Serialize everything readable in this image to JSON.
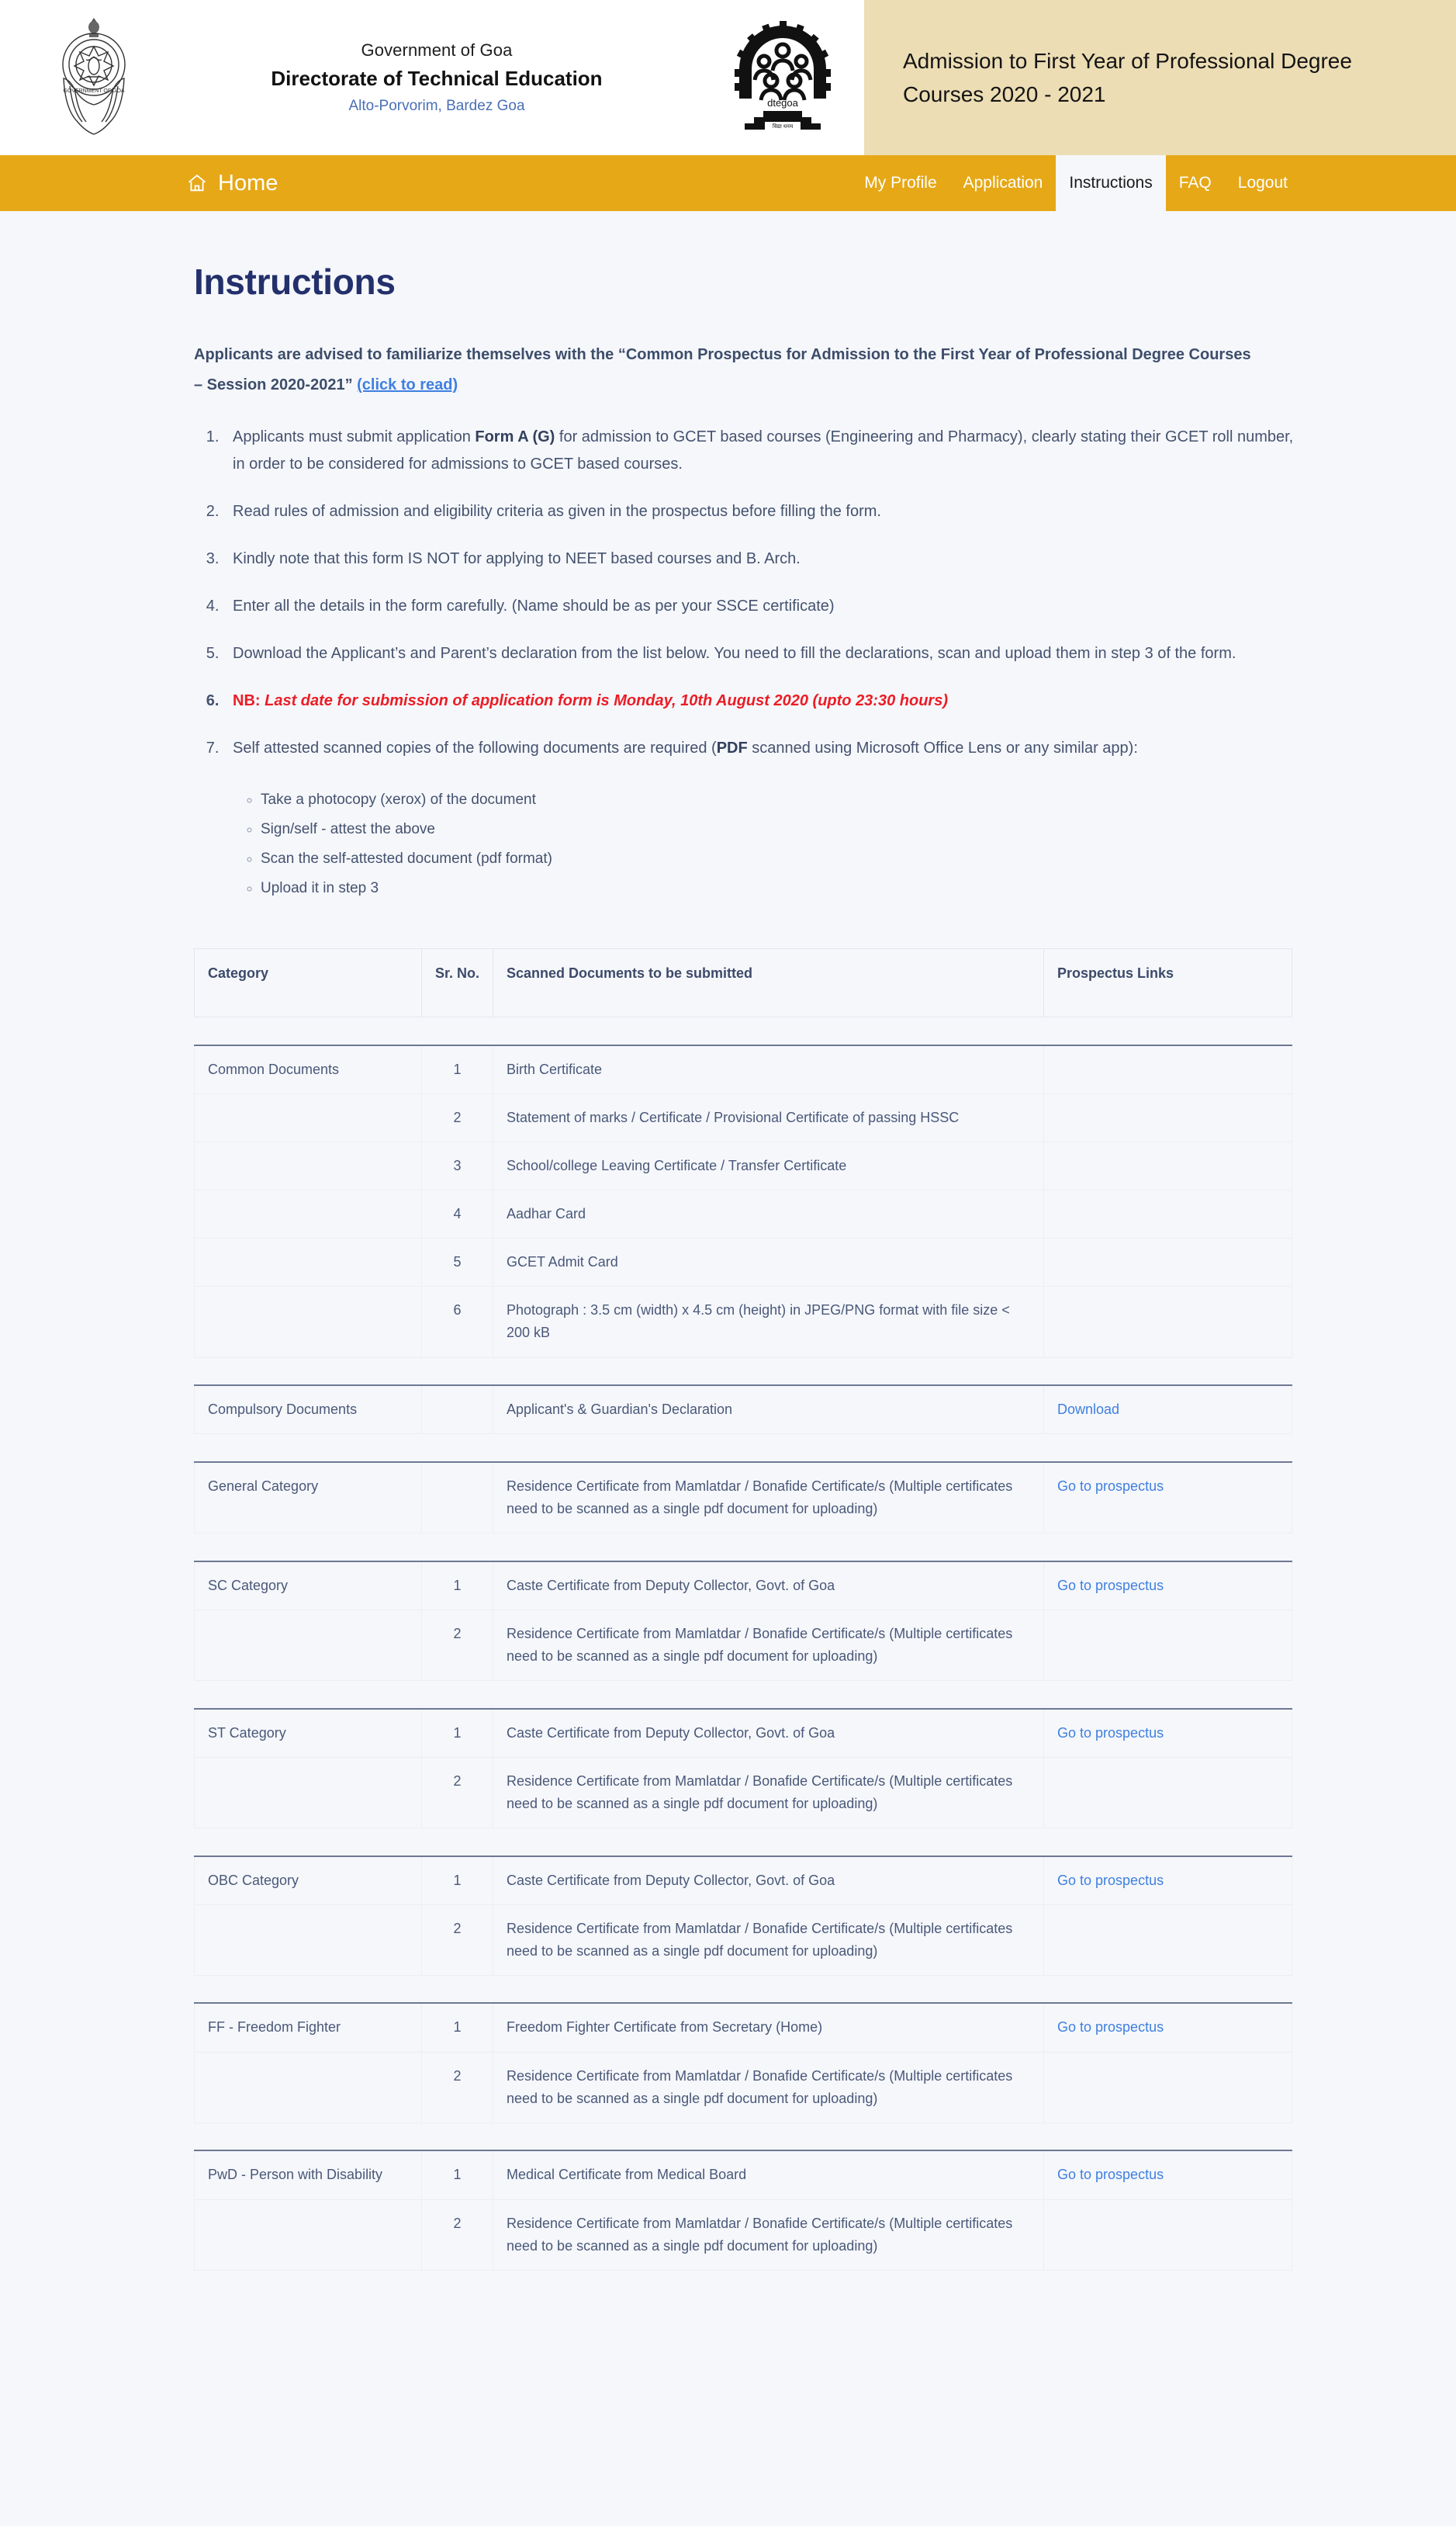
{
  "header": {
    "gov_line": "Government of Goa",
    "org_line": "Directorate of Technical Education",
    "address_line": "Alto-Porvorim, Bardez Goa",
    "banner_title": "Admission to First Year of Professional Degree Courses 2020 - 2021",
    "crest_icon": "goa-government-emblem",
    "dte_icon": "dte-goa-logo"
  },
  "nav": {
    "home_label": "Home",
    "home_icon": "home-icon",
    "items": [
      {
        "label": "My Profile",
        "active": false
      },
      {
        "label": "Application",
        "active": false
      },
      {
        "label": "Instructions",
        "active": true
      },
      {
        "label": "FAQ",
        "active": false
      },
      {
        "label": "Logout",
        "active": false
      }
    ]
  },
  "page": {
    "title": "Instructions",
    "lead_part1": "Applicants are advised to familiarize themselves with the “Common Prospectus for Admission to the First Year of Professional Degree Courses – Session 2020-2021” ",
    "lead_link": "(click to read)",
    "items": [
      {
        "pre": "Applicants must submit application ",
        "bold": "Form A (G)",
        "post": " for admission to GCET based courses (Engineering and Pharmacy), clearly stating their GCET roll number, in order to be considered for admissions to GCET based courses."
      },
      {
        "pre": "Read rules of admission and eligibility criteria as given in the prospectus before filling the form.",
        "bold": "",
        "post": ""
      },
      {
        "pre": "Kindly note that this form IS NOT for applying to NEET based courses and B. Arch.",
        "bold": "",
        "post": ""
      },
      {
        "pre": "Enter all the details in the form carefully. (Name should be as per your SSCE certificate)",
        "bold": "",
        "post": ""
      },
      {
        "pre": "Download the Applicant’s and Parent’s declaration from the list below. You need to fill the declarations, scan and upload them in step 3 of the form.",
        "bold": "",
        "post": ""
      }
    ],
    "nb_item": {
      "label": "NB: ",
      "bold_italic_1": "Last date",
      "italic_mid": " for submission of application form is ",
      "bold_italic_2": "Monday, 10th August 2020 (upto 23:30 hours)"
    },
    "item7": {
      "pre": "Self attested scanned copies of the following documents are required (",
      "bold": "PDF",
      "post": " scanned using Microsoft Office Lens or any similar app):"
    },
    "sub_items": [
      "Take a photocopy (xerox) of the document",
      "Sign/self - attest the above",
      "Scan the self-attested document (pdf format)",
      "Upload it in step 3"
    ]
  },
  "table": {
    "headers": [
      "Category",
      "Sr. No.",
      "Scanned Documents to be submitted",
      "Prospectus Links"
    ],
    "groups": [
      {
        "category": "Common Documents",
        "rows": [
          {
            "sr": "1",
            "doc": "Birth Certificate",
            "link": ""
          },
          {
            "sr": "2",
            "doc": "Statement of marks / Certificate / Provisional Certificate of passing HSSC",
            "link": ""
          },
          {
            "sr": "3",
            "doc": "School/college Leaving Certificate / Transfer Certificate",
            "link": ""
          },
          {
            "sr": "4",
            "doc": "Aadhar Card",
            "link": ""
          },
          {
            "sr": "5",
            "doc": "GCET Admit Card",
            "link": ""
          },
          {
            "sr": "6",
            "doc": "Photograph : 3.5 cm (width) x 4.5 cm (height) in JPEG/PNG format with file size < 200 kB",
            "link": ""
          }
        ]
      },
      {
        "category": "Compulsory Documents",
        "rows": [
          {
            "sr": "",
            "doc": "Applicant's & Guardian's Declaration",
            "link": "Download"
          }
        ]
      },
      {
        "category": "General Category",
        "rows": [
          {
            "sr": "",
            "doc": "Residence Certificate from Mamlatdar / Bonafide Certificate/s (Multiple certificates need to be scanned as a single pdf document for uploading)",
            "link": "Go to prospectus"
          }
        ]
      },
      {
        "category": "SC Category",
        "rows": [
          {
            "sr": "1",
            "doc": "Caste Certificate from Deputy Collector, Govt. of Goa",
            "link": "Go to prospectus"
          },
          {
            "sr": "2",
            "doc": "Residence Certificate from Mamlatdar / Bonafide Certificate/s (Multiple certificates need to be scanned as a single pdf document for uploading)",
            "link": ""
          }
        ]
      },
      {
        "category": "ST Category",
        "rows": [
          {
            "sr": "1",
            "doc": "Caste Certificate from Deputy Collector, Govt. of Goa",
            "link": "Go to prospectus"
          },
          {
            "sr": "2",
            "doc": "Residence Certificate from Mamlatdar / Bonafide Certificate/s (Multiple certificates need to be scanned as a single pdf document for uploading)",
            "link": ""
          }
        ]
      },
      {
        "category": "OBC Category",
        "rows": [
          {
            "sr": "1",
            "doc": "Caste Certificate from Deputy Collector, Govt. of Goa",
            "link": "Go to prospectus"
          },
          {
            "sr": "2",
            "doc": "Residence Certificate from Mamlatdar / Bonafide Certificate/s (Multiple certificates need to be scanned as a single pdf document for uploading)",
            "link": ""
          }
        ]
      },
      {
        "category": "FF - Freedom Fighter",
        "rows": [
          {
            "sr": "1",
            "doc": "Freedom Fighter Certificate from Secretary (Home)",
            "link": "Go to prospectus"
          },
          {
            "sr": "2",
            "doc": "Residence Certificate from Mamlatdar / Bonafide Certificate/s (Multiple certificates need to be scanned as a single pdf document for uploading)",
            "link": ""
          }
        ]
      },
      {
        "category": "PwD - Person with Disability",
        "rows": [
          {
            "sr": "1",
            "doc": "Medical Certificate from Medical Board",
            "link": "Go to prospectus"
          },
          {
            "sr": "2",
            "doc": "Residence Certificate from Mamlatdar / Bonafide Certificate/s (Multiple certificates need to be scanned as a single pdf document for uploading)",
            "link": ""
          }
        ]
      }
    ]
  },
  "colors": {
    "nav_bg": "#e6a817",
    "banner_bg": "#ecddb4",
    "page_bg": "#f5f7fb",
    "title": "#23306b",
    "link": "#3f7fe0",
    "alert": "#ec1c24"
  }
}
